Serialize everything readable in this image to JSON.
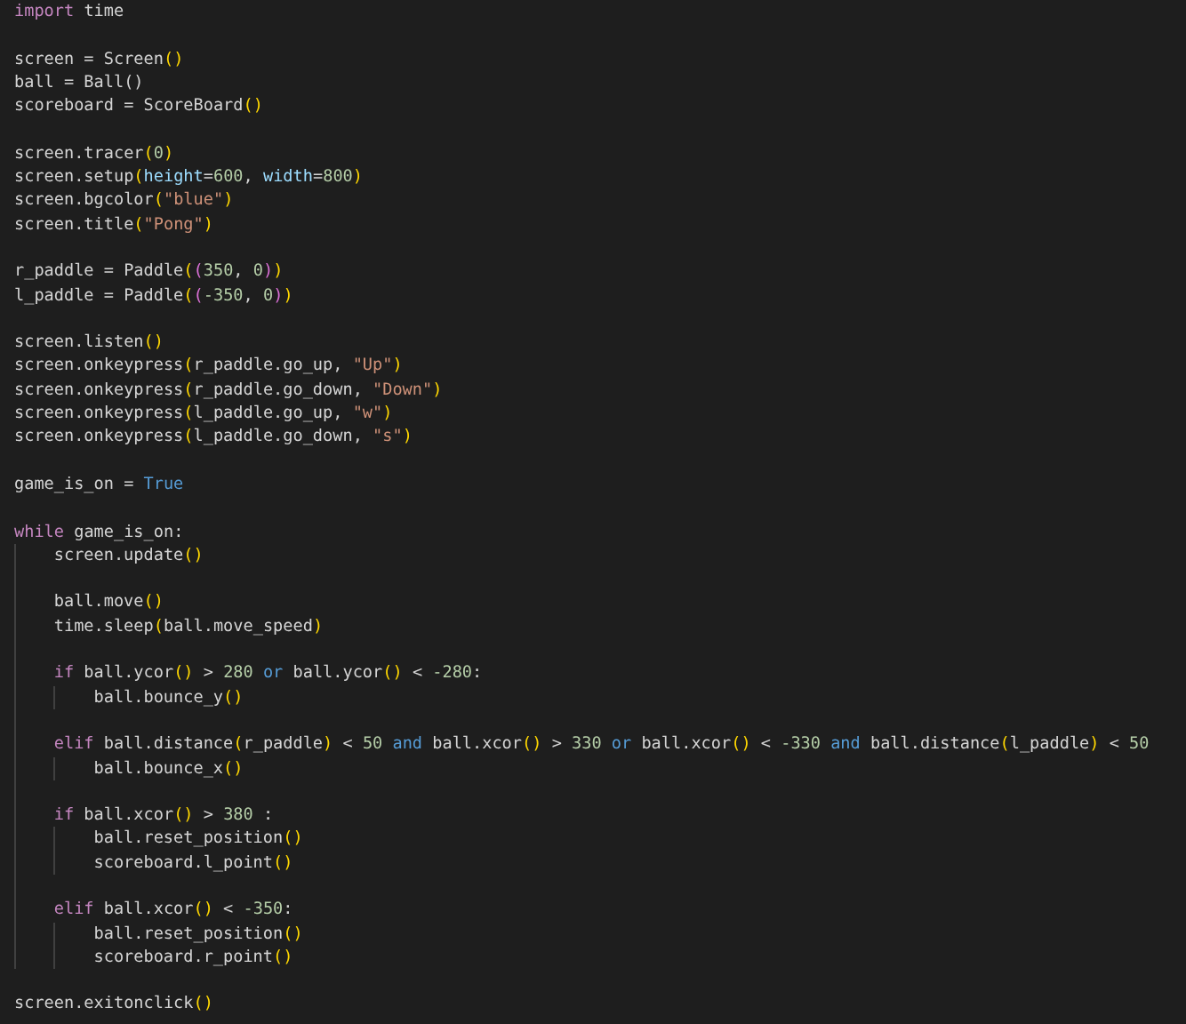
{
  "editor": {
    "lines": [
      {
        "kind": "code",
        "tokens": [
          {
            "kind": "keyword",
            "text": "import"
          },
          {
            "kind": "plain",
            "text": " time"
          }
        ]
      },
      {
        "kind": "blank"
      },
      {
        "kind": "code",
        "tokens": [
          {
            "kind": "plain",
            "text": "screen = Screen"
          },
          {
            "kind": "bracket",
            "text": "()"
          }
        ]
      },
      {
        "kind": "code",
        "tokens": [
          {
            "kind": "plain",
            "text": "ball = Ball()"
          }
        ]
      },
      {
        "kind": "code",
        "tokens": [
          {
            "kind": "plain",
            "text": "scoreboard = ScoreBoard"
          },
          {
            "kind": "bracket",
            "text": "()"
          }
        ]
      },
      {
        "kind": "blank"
      },
      {
        "kind": "code",
        "tokens": [
          {
            "kind": "plain",
            "text": "screen.tracer"
          },
          {
            "kind": "bracket",
            "text": "("
          },
          {
            "kind": "number",
            "text": "0"
          },
          {
            "kind": "bracket",
            "text": ")"
          }
        ]
      },
      {
        "kind": "code",
        "tokens": [
          {
            "kind": "plain",
            "text": "screen.setup"
          },
          {
            "kind": "bracket",
            "text": "("
          },
          {
            "kind": "param",
            "text": "height"
          },
          {
            "kind": "plain",
            "text": "="
          },
          {
            "kind": "number",
            "text": "600"
          },
          {
            "kind": "plain",
            "text": ", "
          },
          {
            "kind": "param",
            "text": "width"
          },
          {
            "kind": "plain",
            "text": "="
          },
          {
            "kind": "number",
            "text": "800"
          },
          {
            "kind": "bracket",
            "text": ")"
          }
        ]
      },
      {
        "kind": "code",
        "tokens": [
          {
            "kind": "plain",
            "text": "screen.bgcolor"
          },
          {
            "kind": "bracket",
            "text": "("
          },
          {
            "kind": "string",
            "text": "\"blue\""
          },
          {
            "kind": "bracket",
            "text": ")"
          }
        ]
      },
      {
        "kind": "code",
        "tokens": [
          {
            "kind": "plain",
            "text": "screen.title"
          },
          {
            "kind": "bracket",
            "text": "("
          },
          {
            "kind": "string",
            "text": "\"Pong\""
          },
          {
            "kind": "bracket",
            "text": ")"
          }
        ]
      },
      {
        "kind": "blank"
      },
      {
        "kind": "code",
        "tokens": [
          {
            "kind": "plain",
            "text": "r_paddle = Paddle"
          },
          {
            "kind": "bracket",
            "text": "("
          },
          {
            "kind": "bracket2",
            "text": "("
          },
          {
            "kind": "number",
            "text": "350"
          },
          {
            "kind": "plain",
            "text": ", "
          },
          {
            "kind": "number",
            "text": "0"
          },
          {
            "kind": "bracket2",
            "text": ")"
          },
          {
            "kind": "bracket",
            "text": ")"
          }
        ]
      },
      {
        "kind": "code",
        "tokens": [
          {
            "kind": "plain",
            "text": "l_paddle = Paddle"
          },
          {
            "kind": "bracket",
            "text": "("
          },
          {
            "kind": "bracket2",
            "text": "("
          },
          {
            "kind": "number",
            "text": "-350"
          },
          {
            "kind": "plain",
            "text": ", "
          },
          {
            "kind": "number",
            "text": "0"
          },
          {
            "kind": "bracket2",
            "text": ")"
          },
          {
            "kind": "bracket",
            "text": ")"
          }
        ]
      },
      {
        "kind": "blank"
      },
      {
        "kind": "code",
        "tokens": [
          {
            "kind": "plain",
            "text": "screen.listen"
          },
          {
            "kind": "bracket",
            "text": "()"
          }
        ]
      },
      {
        "kind": "code",
        "tokens": [
          {
            "kind": "plain",
            "text": "screen.onkeypress"
          },
          {
            "kind": "bracket",
            "text": "("
          },
          {
            "kind": "plain",
            "text": "r_paddle.go_up, "
          },
          {
            "kind": "string",
            "text": "\"Up\""
          },
          {
            "kind": "bracket",
            "text": ")"
          }
        ]
      },
      {
        "kind": "code",
        "tokens": [
          {
            "kind": "plain",
            "text": "screen.onkeypress"
          },
          {
            "kind": "bracket",
            "text": "("
          },
          {
            "kind": "plain",
            "text": "r_paddle.go_down, "
          },
          {
            "kind": "string",
            "text": "\"Down\""
          },
          {
            "kind": "bracket",
            "text": ")"
          }
        ]
      },
      {
        "kind": "code",
        "tokens": [
          {
            "kind": "plain",
            "text": "screen.onkeypress"
          },
          {
            "kind": "bracket",
            "text": "("
          },
          {
            "kind": "plain",
            "text": "l_paddle.go_up, "
          },
          {
            "kind": "string",
            "text": "\"w\""
          },
          {
            "kind": "bracket",
            "text": ")"
          }
        ]
      },
      {
        "kind": "code",
        "tokens": [
          {
            "kind": "plain",
            "text": "screen.onkeypress"
          },
          {
            "kind": "bracket",
            "text": "("
          },
          {
            "kind": "plain",
            "text": "l_paddle.go_down, "
          },
          {
            "kind": "string",
            "text": "\"s\""
          },
          {
            "kind": "bracket",
            "text": ")"
          }
        ]
      },
      {
        "kind": "blank"
      },
      {
        "kind": "code",
        "tokens": [
          {
            "kind": "plain",
            "text": "game_is_on = "
          },
          {
            "kind": "constant",
            "text": "True"
          }
        ]
      },
      {
        "kind": "blank"
      },
      {
        "kind": "code",
        "tokens": [
          {
            "kind": "keyword",
            "text": "while"
          },
          {
            "kind": "plain",
            "text": " game_is_on:"
          }
        ],
        "children": [
          {
            "kind": "code",
            "tokens": [
              {
                "kind": "plain",
                "text": "screen.update"
              },
              {
                "kind": "bracket",
                "text": "()"
              }
            ]
          },
          {
            "kind": "blank"
          },
          {
            "kind": "code",
            "tokens": [
              {
                "kind": "plain",
                "text": "ball.move"
              },
              {
                "kind": "bracket",
                "text": "()"
              }
            ]
          },
          {
            "kind": "code",
            "tokens": [
              {
                "kind": "plain",
                "text": "time.sleep"
              },
              {
                "kind": "bracket",
                "text": "("
              },
              {
                "kind": "plain",
                "text": "ball.move_speed"
              },
              {
                "kind": "bracket",
                "text": ")"
              }
            ]
          },
          {
            "kind": "blank"
          },
          {
            "kind": "code",
            "tokens": [
              {
                "kind": "keyword",
                "text": "if"
              },
              {
                "kind": "plain",
                "text": " ball.ycor"
              },
              {
                "kind": "bracket",
                "text": "()"
              },
              {
                "kind": "plain",
                "text": " > "
              },
              {
                "kind": "number",
                "text": "280"
              },
              {
                "kind": "constant",
                "text": " or"
              },
              {
                "kind": "plain",
                "text": " ball.ycor"
              },
              {
                "kind": "bracket",
                "text": "()"
              },
              {
                "kind": "plain",
                "text": " < "
              },
              {
                "kind": "number",
                "text": "-280"
              },
              {
                "kind": "plain",
                "text": ":"
              }
            ],
            "children": [
              {
                "kind": "code",
                "tokens": [
                  {
                    "kind": "plain",
                    "text": "ball.bounce_y"
                  },
                  {
                    "kind": "bracket",
                    "text": "()"
                  }
                ]
              }
            ]
          },
          {
            "kind": "blank"
          },
          {
            "kind": "code",
            "tokens": [
              {
                "kind": "keyword",
                "text": "elif"
              },
              {
                "kind": "plain",
                "text": " ball.distance"
              },
              {
                "kind": "bracket",
                "text": "("
              },
              {
                "kind": "plain",
                "text": "r_paddle"
              },
              {
                "kind": "bracket",
                "text": ")"
              },
              {
                "kind": "plain",
                "text": " < "
              },
              {
                "kind": "number",
                "text": "50"
              },
              {
                "kind": "constant",
                "text": " and"
              },
              {
                "kind": "plain",
                "text": " ball.xcor"
              },
              {
                "kind": "bracket",
                "text": "()"
              },
              {
                "kind": "plain",
                "text": " > "
              },
              {
                "kind": "number",
                "text": "330"
              },
              {
                "kind": "constant",
                "text": " or"
              },
              {
                "kind": "plain",
                "text": " ball.xcor"
              },
              {
                "kind": "bracket",
                "text": "()"
              },
              {
                "kind": "plain",
                "text": " < "
              },
              {
                "kind": "number",
                "text": "-330"
              },
              {
                "kind": "constant",
                "text": " and"
              },
              {
                "kind": "plain",
                "text": " ball.distance"
              },
              {
                "kind": "bracket",
                "text": "("
              },
              {
                "kind": "plain",
                "text": "l_paddle"
              },
              {
                "kind": "bracket",
                "text": ")"
              },
              {
                "kind": "plain",
                "text": " < "
              },
              {
                "kind": "number",
                "text": "50"
              }
            ],
            "children": [
              {
                "kind": "code",
                "tokens": [
                  {
                    "kind": "plain",
                    "text": "ball.bounce_x"
                  },
                  {
                    "kind": "bracket",
                    "text": "()"
                  }
                ]
              }
            ]
          },
          {
            "kind": "blank"
          },
          {
            "kind": "code",
            "tokens": [
              {
                "kind": "keyword",
                "text": "if"
              },
              {
                "kind": "plain",
                "text": " ball.xcor"
              },
              {
                "kind": "bracket",
                "text": "()"
              },
              {
                "kind": "plain",
                "text": " > "
              },
              {
                "kind": "number",
                "text": "380"
              },
              {
                "kind": "plain",
                "text": " :"
              }
            ],
            "children": [
              {
                "kind": "code",
                "tokens": [
                  {
                    "kind": "plain",
                    "text": "ball.reset_position"
                  },
                  {
                    "kind": "bracket",
                    "text": "()"
                  }
                ]
              },
              {
                "kind": "code",
                "tokens": [
                  {
                    "kind": "plain",
                    "text": "scoreboard.l_point"
                  },
                  {
                    "kind": "bracket",
                    "text": "()"
                  }
                ]
              }
            ]
          },
          {
            "kind": "blank"
          },
          {
            "kind": "code",
            "tokens": [
              {
                "kind": "keyword",
                "text": "elif"
              },
              {
                "kind": "plain",
                "text": " ball.xcor"
              },
              {
                "kind": "bracket",
                "text": "()"
              },
              {
                "kind": "plain",
                "text": " < "
              },
              {
                "kind": "number",
                "text": "-350"
              },
              {
                "kind": "plain",
                "text": ":"
              }
            ],
            "children": [
              {
                "kind": "code",
                "tokens": [
                  {
                    "kind": "plain",
                    "text": "ball.reset_position"
                  },
                  {
                    "kind": "bracket",
                    "text": "()"
                  }
                ]
              },
              {
                "kind": "code",
                "tokens": [
                  {
                    "kind": "plain",
                    "text": "scoreboard.r_point"
                  },
                  {
                    "kind": "bracket",
                    "text": "()"
                  }
                ]
              }
            ]
          }
        ]
      },
      {
        "kind": "blank"
      },
      {
        "kind": "code",
        "tokens": [
          {
            "kind": "plain",
            "text": "screen.exitonclick"
          },
          {
            "kind": "bracket",
            "text": "()"
          }
        ]
      }
    ]
  }
}
